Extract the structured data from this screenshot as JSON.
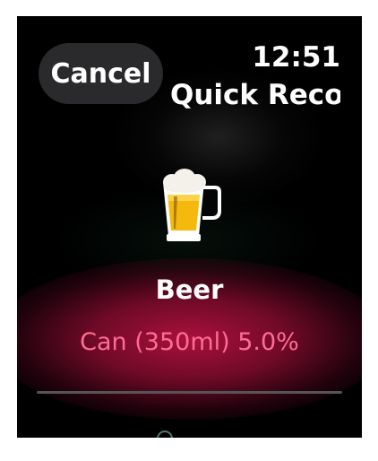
{
  "header": {
    "cancel_label": "Cancel",
    "time": "12:51",
    "title": "Quick Record"
  },
  "drink": {
    "icon": "beer-mug-icon",
    "name": "Beer",
    "detail": "Can (350ml) 5.0%"
  },
  "colors": {
    "accent_pink": "#ff6c93",
    "glow_pink": "#c8144a",
    "beer_yellow": "#f5b80c"
  }
}
